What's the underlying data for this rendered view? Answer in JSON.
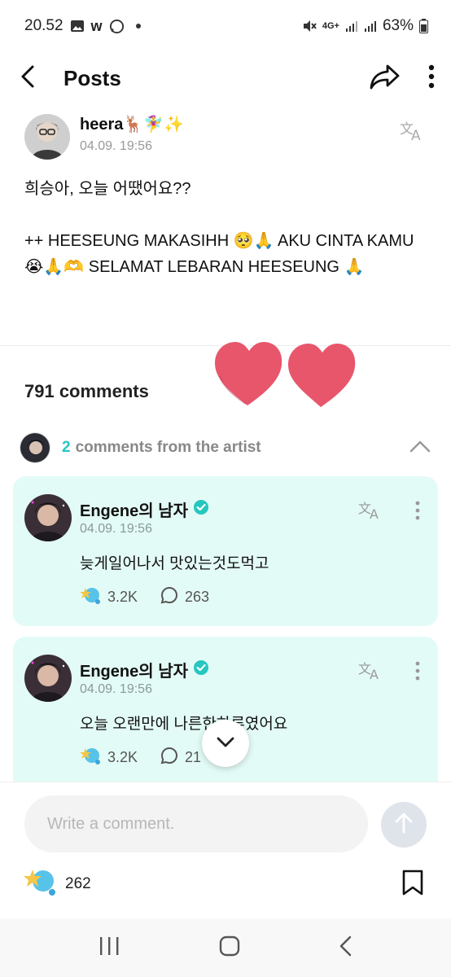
{
  "status_bar": {
    "time": "20.52",
    "battery": "63%",
    "network": "4G+"
  },
  "app_bar": {
    "title": "Posts"
  },
  "post": {
    "author": "heera🦌🧚‍♀️✨",
    "date": "04.09. 19:56",
    "body": "희승아, 오늘 어땠어요??\n\n++ HEESEUNG MAKASIHH 🥺🙏 AKU CINTA KAMU 😭🙏🫶 SELAMAT LEBARAN HEESEUNG 🙏"
  },
  "comments_section": {
    "count_label": "791 comments",
    "artist_count": "2",
    "artist_label": "comments from the artist"
  },
  "comments": [
    {
      "name": "Engene의 남자",
      "date": "04.09. 19:56",
      "text": "늦게일어나서 맛있는것도먹고",
      "likes": "3.2K",
      "replies": "263"
    },
    {
      "name": "Engene의 남자",
      "date": "04.09. 19:56",
      "text": "오늘 오랜만에 나른한하루였어요",
      "likes": "3.2K",
      "replies": "21"
    }
  ],
  "composer": {
    "placeholder": "Write a comment.",
    "like_count": "262"
  },
  "colors": {
    "accent": "#27c6c0",
    "card_bg": "#e3fbf6",
    "heart": "#e8566c"
  }
}
